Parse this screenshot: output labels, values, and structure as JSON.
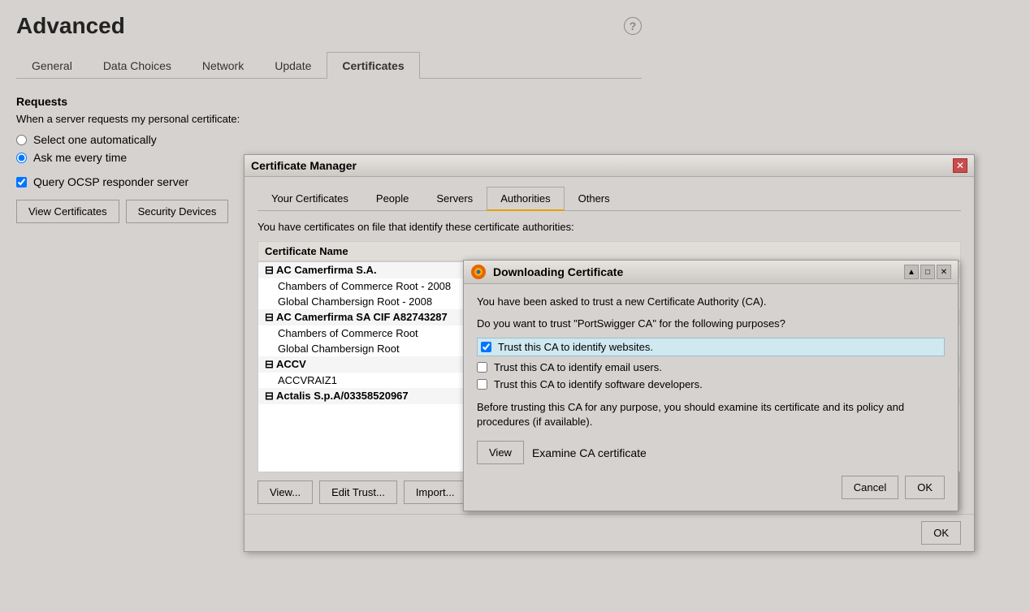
{
  "page": {
    "title": "Advanced",
    "help_icon": "?",
    "tabs": [
      {
        "label": "General",
        "active": false
      },
      {
        "label": "Data Choices",
        "active": false
      },
      {
        "label": "Network",
        "active": false
      },
      {
        "label": "Update",
        "active": false
      },
      {
        "label": "Certificates",
        "active": true
      }
    ]
  },
  "certificates_section": {
    "requests_title": "Requests",
    "requests_subtitle": "When a server requests my personal certificate:",
    "radio_select_auto": "Select one automatically",
    "radio_ask_every": "Ask me every time",
    "checkbox_ocsp": "Query OCSP responder server",
    "button_view": "View Certificates",
    "button_security": "Security Devices"
  },
  "cert_manager": {
    "title": "Certificate Manager",
    "tabs": [
      {
        "label": "Your Certificates"
      },
      {
        "label": "People"
      },
      {
        "label": "Servers"
      },
      {
        "label": "Authorities",
        "active": true
      },
      {
        "label": "Others"
      }
    ],
    "description": "You have certificates on file that identify these certificate authorities:",
    "column_name": "Certificate Name",
    "cert_groups": [
      {
        "name": "AC Camerfirma S.A.",
        "items": [
          "Chambers of Commerce Root - 2008",
          "Global Chambersign Root - 2008"
        ]
      },
      {
        "name": "AC Camerfirma SA CIF A82743287",
        "items": [
          "Chambers of Commerce Root",
          "Global Chambersign Root"
        ]
      },
      {
        "name": "ACCV",
        "items": [
          "ACCVRAIZ1"
        ]
      },
      {
        "name": "Actalis S.p.A/03358520967",
        "items": []
      }
    ],
    "buttons": [
      "View...",
      "Edit Trust...",
      "Import..."
    ],
    "ok_button": "OK"
  },
  "download_cert": {
    "title": "Downloading Certificate",
    "firefox_logo": "firefox",
    "ask_text": "You have been asked to trust a new Certificate Authority (CA).",
    "question_text": "Do you want to trust \"PortSwigger CA\" for the following purposes?",
    "trust_options": [
      {
        "label": "Trust this CA to identify websites.",
        "checked": true,
        "highlighted": true
      },
      {
        "label": "Trust this CA to identify email users.",
        "checked": false
      },
      {
        "label": "Trust this CA to identify software developers.",
        "checked": false
      }
    ],
    "notice_text": "Before trusting this CA for any purpose, you should examine its certificate and its policy and procedures (if available).",
    "view_button": "View",
    "view_label": "Examine CA certificate",
    "cancel_button": "Cancel",
    "ok_button": "OK"
  }
}
